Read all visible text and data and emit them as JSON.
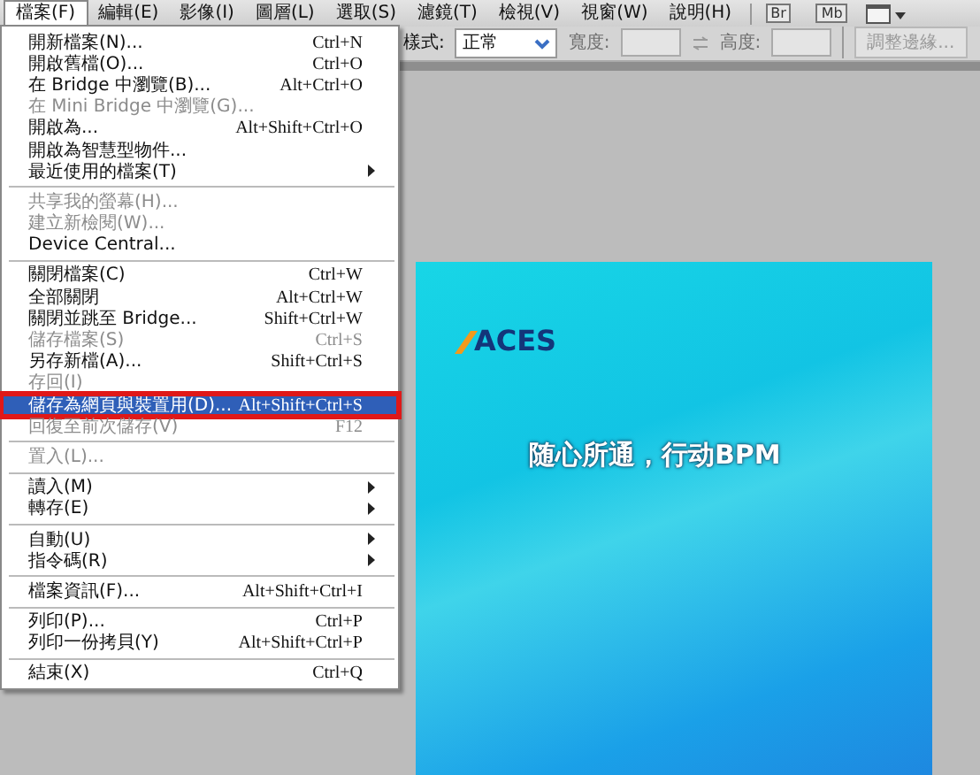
{
  "menubar": [
    {
      "label": "檔案(F)",
      "selected": true
    },
    {
      "label": "編輯(E)",
      "selected": false
    },
    {
      "label": "影像(I)",
      "selected": false
    },
    {
      "label": "圖層(L)",
      "selected": false
    },
    {
      "label": "選取(S)",
      "selected": false
    },
    {
      "label": "濾鏡(T)",
      "selected": false
    },
    {
      "label": "檢視(V)",
      "selected": false
    },
    {
      "label": "視窗(W)",
      "selected": false
    },
    {
      "label": "說明(H)",
      "selected": false
    }
  ],
  "app_buttons": [
    {
      "kind": "badge",
      "label": "Br"
    },
    {
      "kind": "badge",
      "label": "Mb"
    },
    {
      "kind": "screen"
    }
  ],
  "options_bar": {
    "style_label": "樣式:",
    "style_value": "正常",
    "width_label": "寬度:",
    "height_label": "高度:",
    "refine_button": "調整邊緣..."
  },
  "file_menu": [
    {
      "kind": "item",
      "label": "開新檔案(N)...",
      "shortcut": "Ctrl+N",
      "disabled": false,
      "submenu": false,
      "selected": false,
      "annotated": false
    },
    {
      "kind": "item",
      "label": "開啟舊檔(O)...",
      "shortcut": "Ctrl+O",
      "disabled": false,
      "submenu": false,
      "selected": false,
      "annotated": false
    },
    {
      "kind": "item",
      "label": "在 Bridge 中瀏覽(B)...",
      "shortcut": "Alt+Ctrl+O",
      "disabled": false,
      "submenu": false,
      "selected": false,
      "annotated": false
    },
    {
      "kind": "item",
      "label": "在 Mini Bridge 中瀏覽(G)...",
      "disabled": true,
      "submenu": false,
      "selected": false,
      "annotated": false
    },
    {
      "kind": "item",
      "label": "開啟為...",
      "shortcut": "Alt+Shift+Ctrl+O",
      "disabled": false,
      "submenu": false,
      "selected": false,
      "annotated": false
    },
    {
      "kind": "item",
      "label": "開啟為智慧型物件...",
      "disabled": false,
      "submenu": false,
      "selected": false,
      "annotated": false
    },
    {
      "kind": "item",
      "label": "最近使用的檔案(T)",
      "disabled": false,
      "submenu": true,
      "selected": false,
      "annotated": false
    },
    {
      "kind": "separator"
    },
    {
      "kind": "item",
      "label": "共享我的螢幕(H)...",
      "disabled": true,
      "submenu": false,
      "selected": false,
      "annotated": false
    },
    {
      "kind": "item",
      "label": "建立新檢閱(W)...",
      "disabled": true,
      "submenu": false,
      "selected": false,
      "annotated": false
    },
    {
      "kind": "item",
      "label": "Device Central...",
      "disabled": false,
      "submenu": false,
      "selected": false,
      "annotated": false
    },
    {
      "kind": "separator"
    },
    {
      "kind": "item",
      "label": "關閉檔案(C)",
      "shortcut": "Ctrl+W",
      "disabled": false,
      "submenu": false,
      "selected": false,
      "annotated": false
    },
    {
      "kind": "item",
      "label": "全部關閉",
      "shortcut": "Alt+Ctrl+W",
      "disabled": false,
      "submenu": false,
      "selected": false,
      "annotated": false
    },
    {
      "kind": "item",
      "label": "關閉並跳至 Bridge...",
      "shortcut": "Shift+Ctrl+W",
      "disabled": false,
      "submenu": false,
      "selected": false,
      "annotated": false
    },
    {
      "kind": "item",
      "label": "儲存檔案(S)",
      "shortcut": "Ctrl+S",
      "disabled": true,
      "submenu": false,
      "selected": false,
      "annotated": false
    },
    {
      "kind": "item",
      "label": "另存新檔(A)...",
      "shortcut": "Shift+Ctrl+S",
      "disabled": false,
      "submenu": false,
      "selected": false,
      "annotated": false
    },
    {
      "kind": "item",
      "label": "存回(I)",
      "disabled": true,
      "submenu": false,
      "selected": false,
      "annotated": false
    },
    {
      "kind": "item",
      "label": "儲存為網頁與裝置用(D)...",
      "shortcut": "Alt+Shift+Ctrl+S",
      "disabled": false,
      "submenu": false,
      "selected": true,
      "annotated": true
    },
    {
      "kind": "item",
      "label": "回復至前次儲存(V)",
      "shortcut": "F12",
      "disabled": true,
      "submenu": false,
      "selected": false,
      "annotated": false
    },
    {
      "kind": "separator"
    },
    {
      "kind": "item",
      "label": "置入(L)...",
      "disabled": true,
      "submenu": false,
      "selected": false,
      "annotated": false
    },
    {
      "kind": "separator"
    },
    {
      "kind": "item",
      "label": "讀入(M)",
      "disabled": false,
      "submenu": true,
      "selected": false,
      "annotated": false
    },
    {
      "kind": "item",
      "label": "轉存(E)",
      "disabled": false,
      "submenu": true,
      "selected": false,
      "annotated": false
    },
    {
      "kind": "separator"
    },
    {
      "kind": "item",
      "label": "自動(U)",
      "disabled": false,
      "submenu": true,
      "selected": false,
      "annotated": false
    },
    {
      "kind": "item",
      "label": "指令碼(R)",
      "disabled": false,
      "submenu": true,
      "selected": false,
      "annotated": false
    },
    {
      "kind": "separator"
    },
    {
      "kind": "item",
      "label": "檔案資訊(F)...",
      "shortcut": "Alt+Shift+Ctrl+I",
      "disabled": false,
      "submenu": false,
      "selected": false,
      "annotated": false
    },
    {
      "kind": "separator"
    },
    {
      "kind": "item",
      "label": "列印(P)...",
      "shortcut": "Ctrl+P",
      "disabled": false,
      "submenu": false,
      "selected": false,
      "annotated": false
    },
    {
      "kind": "item",
      "label": "列印一份拷貝(Y)",
      "shortcut": "Alt+Shift+Ctrl+P",
      "disabled": false,
      "submenu": false,
      "selected": false,
      "annotated": false
    },
    {
      "kind": "separator"
    },
    {
      "kind": "item",
      "label": "結束(X)",
      "shortcut": "Ctrl+Q",
      "disabled": false,
      "submenu": false,
      "selected": false,
      "annotated": false
    }
  ],
  "canvas": {
    "logo": "ACES",
    "slogan": "随心所通，行动BPM"
  }
}
